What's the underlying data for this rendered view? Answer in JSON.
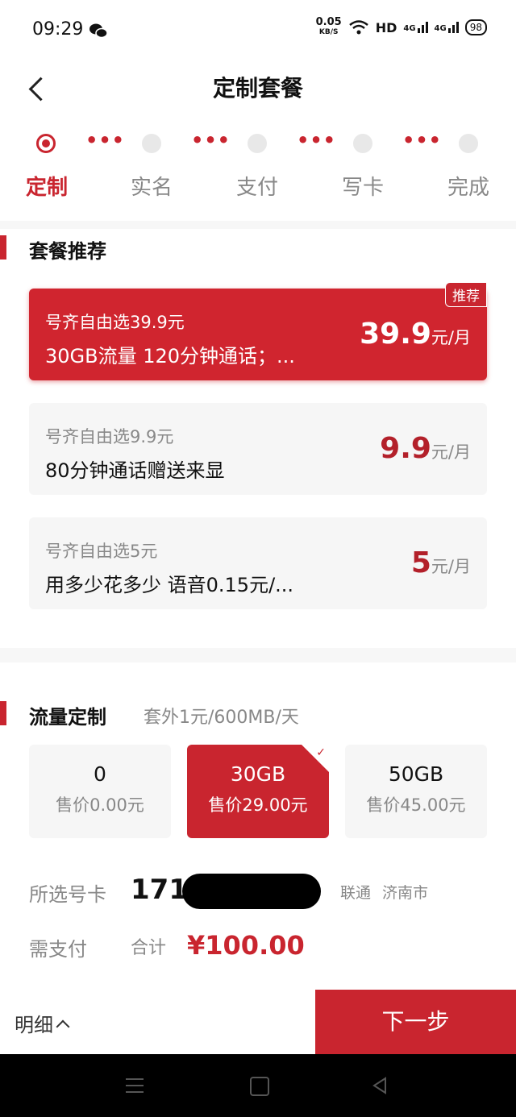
{
  "status": {
    "time": "09:29",
    "speed_value": "0.05",
    "speed_unit": "KB/S",
    "hd": "HD",
    "net1": "4G",
    "net2": "4G",
    "battery": "98"
  },
  "header": {
    "title": "定制套餐"
  },
  "steps": [
    "定制",
    "实名",
    "支付",
    "写卡",
    "完成"
  ],
  "plans_section": {
    "title": "套餐推荐"
  },
  "plans": [
    {
      "name": "号齐自由选39.9元",
      "desc": "30GB流量 120分钟通话；...",
      "price": "39.9",
      "unit": "元/月",
      "tag": "推荐"
    },
    {
      "name": "号齐自由选9.9元",
      "desc": " 80分钟通话赠送来显",
      "price": "9.9",
      "unit": "元/月"
    },
    {
      "name": "号齐自由选5元",
      "desc": "用多少花多少 语音0.15元/...",
      "price": "5",
      "unit": "元/月"
    }
  ],
  "flow_section": {
    "title": "流量定制",
    "subtitle": "套外1元/600MB/天"
  },
  "flow_options": [
    {
      "amount": "0",
      "price": "售价0.00元"
    },
    {
      "amount": "30GB",
      "price": "售价29.00元"
    },
    {
      "amount": "50GB",
      "price": "售价45.00元"
    }
  ],
  "number": {
    "label": "所选号卡",
    "prefix": "171",
    "carrier": "联通",
    "city": "济南市"
  },
  "payment": {
    "label": "需支付",
    "total_label": "合计",
    "amount": "¥100.00"
  },
  "footer": {
    "detail": "明细",
    "next": "下一步"
  },
  "colors": {
    "accent": "#c9252f"
  }
}
